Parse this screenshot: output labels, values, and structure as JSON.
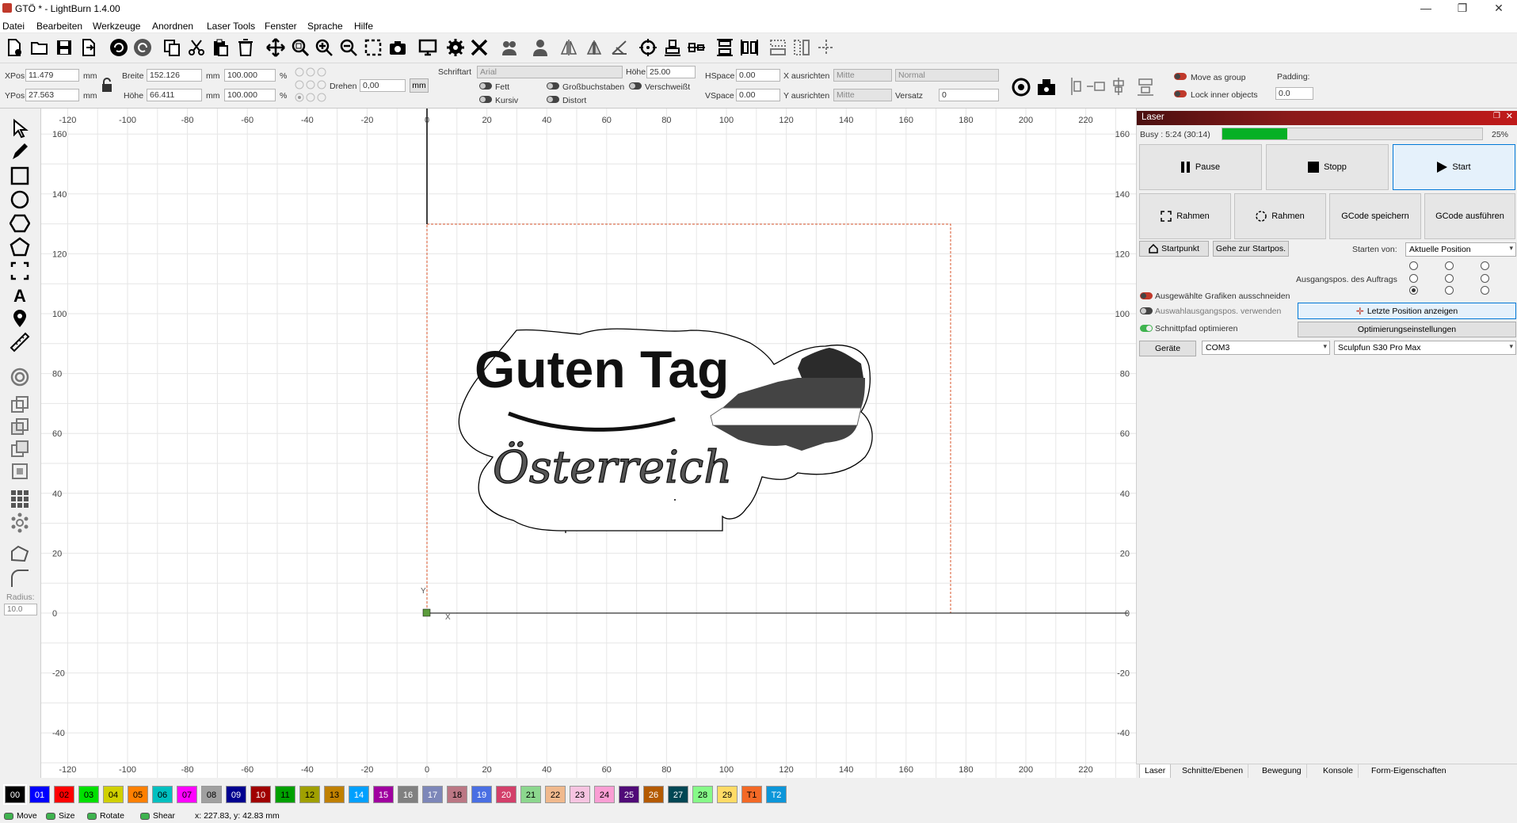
{
  "window": {
    "title": "GTÖ * - LightBurn 1.4.00",
    "controls": [
      "—",
      "❐",
      "✕"
    ]
  },
  "menu": [
    "Datei",
    "Bearbeiten",
    "Werkzeuge",
    "Anordnen",
    "Laser Tools",
    "Fenster",
    "Sprache",
    "Hilfe"
  ],
  "props": {
    "xpos_label": "XPos",
    "xpos": "11.479",
    "ypos_label": "YPos",
    "ypos": "27.563",
    "unit": "mm",
    "breite_label": "Breite",
    "breite": "152.126",
    "hoehe_label": "Höhe",
    "hoehe": "66.411",
    "scale_w": "100.000",
    "scale_h": "100.000",
    "pct": "%",
    "drehen_label": "Drehen",
    "drehen": "0,00",
    "mm_btn": "mm",
    "schriftart_label": "Schriftart",
    "schriftart": "Arial",
    "font_hoehe_label": "Höhe",
    "font_hoehe": "25.00",
    "hspace_label": "HSpace",
    "hspace": "0.00",
    "vspace_label": "VSpace",
    "vspace": "0.00",
    "x_align_label": "X ausrichten",
    "x_align": "Mitte",
    "y_align_label": "Y ausrichten",
    "y_align": "Mitte",
    "normal": "Normal",
    "versatz_label": "Versatz",
    "versatz": "0",
    "fett": "Fett",
    "kursiv": "Kursiv",
    "grossbuchstaben": "Großbuchstaben",
    "distort": "Distort",
    "verschweisst": "Verschweißt",
    "move_as_group": "Move as group",
    "lock_inner": "Lock inner objects",
    "padding_label": "Padding:",
    "padding": "0.0"
  },
  "left_tools": {
    "radius_label": "Radius:",
    "radius": "10.0"
  },
  "canvas": {
    "x_ticks": [
      "-120",
      "-100",
      "-80",
      "-60",
      "-40",
      "-20",
      "0",
      "20",
      "40",
      "60",
      "80",
      "100",
      "120",
      "140",
      "160",
      "180",
      "200",
      "220"
    ],
    "y_ticks": [
      "160",
      "140",
      "120",
      "100",
      "80",
      "60",
      "40",
      "20",
      "0",
      "-20",
      "-40"
    ],
    "right_y_ticks": [
      "160",
      "140",
      "120",
      "100",
      "80",
      "60",
      "40",
      "20",
      "0",
      "-20",
      "-40"
    ],
    "axis_x": "X",
    "axis_y": "Y",
    "art_line1": "Guten Tag",
    "art_line2": "Österreich"
  },
  "laser": {
    "panel_title": "Laser",
    "busy": "Busy : 5:24 (30:14)",
    "progress": 0.25,
    "progress_label": "25%",
    "pause": "Pause",
    "stopp": "Stopp",
    "start": "Start",
    "rahmen1": "Rahmen",
    "rahmen2": "Rahmen",
    "gcode_save": "GCode speichern",
    "gcode_run": "GCode ausführen",
    "startpunkt": "Startpunkt",
    "gehe": "Gehe zur Startpos.",
    "starten_von_label": "Starten von:",
    "starten_von": "Aktuelle Position",
    "ausgangspos_label": "Ausgangspos. des Auftrags",
    "cut_selected": "Ausgewählte Grafiken ausschneiden",
    "use_selection_origin": "Auswahlausgangspos. verwenden",
    "optimize": "Schnittpfad optimieren",
    "last_pos": "Letzte Position anzeigen",
    "opt_settings": "Optimierungseinstellungen",
    "geraete": "Geräte",
    "port": "COM3",
    "device": "Sculpfun S30 Pro Max"
  },
  "bottom_tabs": [
    "Laser",
    "Schnitte/Ebenen",
    "Bewegung",
    "Konsole",
    "Form-Eigenschaften"
  ],
  "palette": [
    {
      "label": "00",
      "bg": "#000000",
      "fg": "#ffffff"
    },
    {
      "label": "01",
      "bg": "#0000ff",
      "fg": "#ffffff"
    },
    {
      "label": "02",
      "bg": "#ff0000",
      "fg": "#000000"
    },
    {
      "label": "03",
      "bg": "#00e000",
      "fg": "#000000"
    },
    {
      "label": "04",
      "bg": "#d0d000",
      "fg": "#000000"
    },
    {
      "label": "05",
      "bg": "#ff8000",
      "fg": "#000000"
    },
    {
      "label": "06",
      "bg": "#00c0c0",
      "fg": "#000000"
    },
    {
      "label": "07",
      "bg": "#ff00ff",
      "fg": "#000000"
    },
    {
      "label": "08",
      "bg": "#a0a0a0",
      "fg": "#000000"
    },
    {
      "label": "09",
      "bg": "#000090",
      "fg": "#ffffff"
    },
    {
      "label": "10",
      "bg": "#a00000",
      "fg": "#ffffff"
    },
    {
      "label": "11",
      "bg": "#00a000",
      "fg": "#000000"
    },
    {
      "label": "12",
      "bg": "#a0a000",
      "fg": "#000000"
    },
    {
      "label": "13",
      "bg": "#c08000",
      "fg": "#000000"
    },
    {
      "label": "14",
      "bg": "#00a0ff",
      "fg": "#ffffff"
    },
    {
      "label": "15",
      "bg": "#a000a0",
      "fg": "#ffffff"
    },
    {
      "label": "16",
      "bg": "#808080",
      "fg": "#ffffff"
    },
    {
      "label": "17",
      "bg": "#7d87b9",
      "fg": "#ffffff"
    },
    {
      "label": "18",
      "bg": "#bb7784",
      "fg": "#000000"
    },
    {
      "label": "19",
      "bg": "#4a6fe3",
      "fg": "#ffffff"
    },
    {
      "label": "20",
      "bg": "#d33f6a",
      "fg": "#ffffff"
    },
    {
      "label": "21",
      "bg": "#8cd78e",
      "fg": "#000000"
    },
    {
      "label": "22",
      "bg": "#f0b98d",
      "fg": "#000000"
    },
    {
      "label": "23",
      "bg": "#f6c4e1",
      "fg": "#000000"
    },
    {
      "label": "24",
      "bg": "#fa9ed4",
      "fg": "#000000"
    },
    {
      "label": "25",
      "bg": "#500a78",
      "fg": "#ffffff"
    },
    {
      "label": "26",
      "bg": "#b45a00",
      "fg": "#ffffff"
    },
    {
      "label": "27",
      "bg": "#004754",
      "fg": "#ffffff"
    },
    {
      "label": "28",
      "bg": "#86fa88",
      "fg": "#000000"
    },
    {
      "label": "29",
      "bg": "#ffdb66",
      "fg": "#000000"
    },
    {
      "label": "T1",
      "bg": "#f36926",
      "fg": "#000000"
    },
    {
      "label": "T2",
      "bg": "#0c96d9",
      "fg": "#ffffff"
    }
  ],
  "status": {
    "move": "Move",
    "size": "Size",
    "rotate": "Rotate",
    "shear": "Shear",
    "coords": "x: 227.83, y: 42.83 mm"
  }
}
